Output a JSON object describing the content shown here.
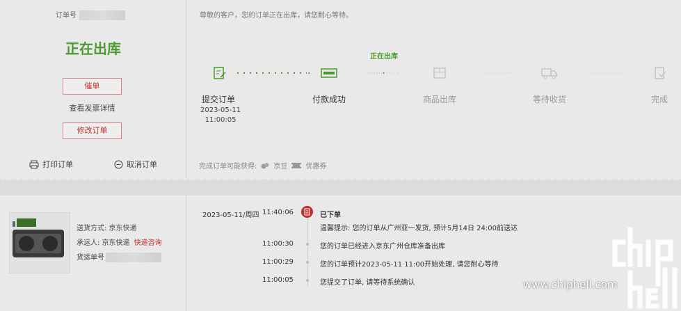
{
  "order": {
    "order_no_label": "订单号",
    "status_title": "正在出库",
    "urge_button": "催单",
    "invoice_button": "查看发票详情",
    "modify_button": "修改订单",
    "print_label": "打印订单",
    "cancel_label": "取消订单"
  },
  "progress": {
    "notice": "尊敬的客户，您的订单正在出库，请您耐心等待。",
    "current_label": "正在出库",
    "steps": [
      {
        "name": "提交订单",
        "date": "2023-05-11",
        "time": "11:00:05"
      },
      {
        "name": "付款成功"
      },
      {
        "name": "商品出库"
      },
      {
        "name": "等待收货"
      },
      {
        "name": "完成"
      }
    ],
    "gain_label": "完成订单可能获得:",
    "gain_items": [
      "京豆",
      "优惠券"
    ]
  },
  "shipping": {
    "method_label": "送货方式: 京东快递",
    "carrier_label": "承运人: 京东快递",
    "carrier_link": "快递咨询",
    "tracking_label": "货运单号"
  },
  "timeline": {
    "date": "2023-05-11/周四",
    "events": [
      {
        "time": "11:40:06",
        "title": "已下单",
        "text": "温馨提示: 您的订单从广州亚一发货, 预计5月14日 24:00前送达"
      },
      {
        "time": "11:00:30",
        "text": "您的订单已经进入京东广州仓库准备出库"
      },
      {
        "time": "11:00:29",
        "text": "您的订单预计2023-05-11 11:00开始处理, 请您耐心等待"
      },
      {
        "time": "11:00:05",
        "text": "您提交了订单, 请等待系统确认"
      }
    ]
  },
  "watermark": {
    "site": "www.chiphell.com"
  },
  "colors": {
    "accent_green": "#4c9a2e",
    "accent_red": "#c0302b"
  }
}
